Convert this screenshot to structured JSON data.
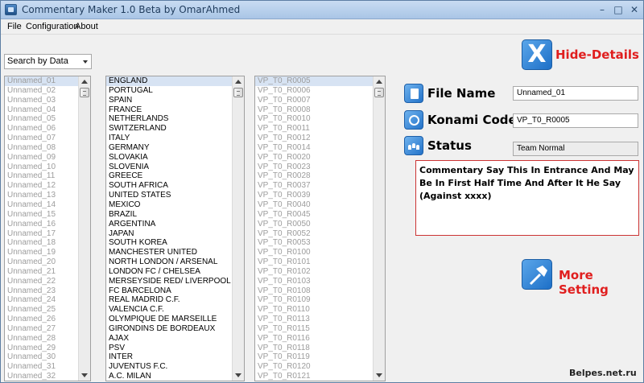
{
  "window": {
    "title": "Commentary Maker 1.0 Beta by OmarAhmed",
    "minimize": "–",
    "maximize": "□",
    "close": "✕"
  },
  "menu": [
    "File",
    "Configuration",
    "About"
  ],
  "search_combo": {
    "value": "Search by Data"
  },
  "list1": {
    "selected_index": 0,
    "items": [
      "Unnamed_01",
      "Unnamed_02",
      "Unnamed_03",
      "Unnamed_04",
      "Unnamed_05",
      "Unnamed_06",
      "Unnamed_07",
      "Unnamed_08",
      "Unnamed_09",
      "Unnamed_10",
      "Unnamed_11",
      "Unnamed_12",
      "Unnamed_13",
      "Unnamed_14",
      "Unnamed_15",
      "Unnamed_16",
      "Unnamed_17",
      "Unnamed_18",
      "Unnamed_19",
      "Unnamed_20",
      "Unnamed_21",
      "Unnamed_22",
      "Unnamed_23",
      "Unnamed_24",
      "Unnamed_25",
      "Unnamed_26",
      "Unnamed_27",
      "Unnamed_28",
      "Unnamed_29",
      "Unnamed_30",
      "Unnamed_31",
      "Unnamed_32"
    ]
  },
  "list2": {
    "selected_index": 0,
    "items": [
      "ENGLAND",
      "PORTUGAL",
      "SPAIN",
      "FRANCE",
      "NETHERLANDS",
      "SWITZERLAND",
      "ITALY",
      "GERMANY",
      "SLOVAKIA",
      "SLOVENIA",
      "GREECE",
      "SOUTH AFRICA",
      "UNITED STATES",
      "MEXICO",
      "BRAZIL",
      "ARGENTINA",
      "JAPAN",
      "SOUTH KOREA",
      "MANCHESTER UNITED",
      "NORTH LONDON / ARSENAL",
      "LONDON FC / CHELSEA",
      "MERSEYSIDE RED/ LIVERPOOL FC",
      "FC BARCELONA",
      "REAL MADRID C.F.",
      "VALENCIA C.F.",
      "OLYMPIQUE DE MARSEILLE",
      "GIRONDINS DE BORDEAUX",
      "AJAX",
      "PSV",
      "INTER",
      "JUVENTUS F.C.",
      "A.C. MILAN"
    ]
  },
  "list3": {
    "selected_index": 0,
    "items": [
      "VP_T0_R0005",
      "VP_T0_R0006",
      "VP_T0_R0007",
      "VP_T0_R0008",
      "VP_T0_R0010",
      "VP_T0_R0011",
      "VP_T0_R0012",
      "VP_T0_R0014",
      "VP_T0_R0020",
      "VP_T0_R0023",
      "VP_T0_R0028",
      "VP_T0_R0037",
      "VP_T0_R0039",
      "VP_T0_R0040",
      "VP_T0_R0045",
      "VP_T0_R0050",
      "VP_T0_R0052",
      "VP_T0_R0053",
      "VP_T0_R0100",
      "VP_T0_R0101",
      "VP_T0_R0102",
      "VP_T0_R0103",
      "VP_T0_R0108",
      "VP_T0_R0109",
      "VP_T0_R0110",
      "VP_T0_R0113",
      "VP_T0_R0115",
      "VP_T0_R0116",
      "VP_T0_R0118",
      "VP_T0_R0119",
      "VP_T0_R0120",
      "VP_T0_R0121"
    ]
  },
  "details": {
    "hide_label": "Hide-Details",
    "hide_icon": "X",
    "file_name_label": "File Name",
    "file_name_value": "Unnamed_01",
    "konami_label": "Konami Code",
    "konami_value": "VP_T0_R0005",
    "status_label": "Status",
    "status_value": "Team Normal",
    "commentary_text": "Commentary Say This In Entrance And May Be In First Half Time And After It He Say (Against xxxx)",
    "more_label": "More Setting"
  },
  "watermark": "Belpes.net.ru",
  "colors": {
    "accent_red": "#e01e1e",
    "button_blue": "#2f80d6",
    "selection": "#d7e3f3"
  }
}
